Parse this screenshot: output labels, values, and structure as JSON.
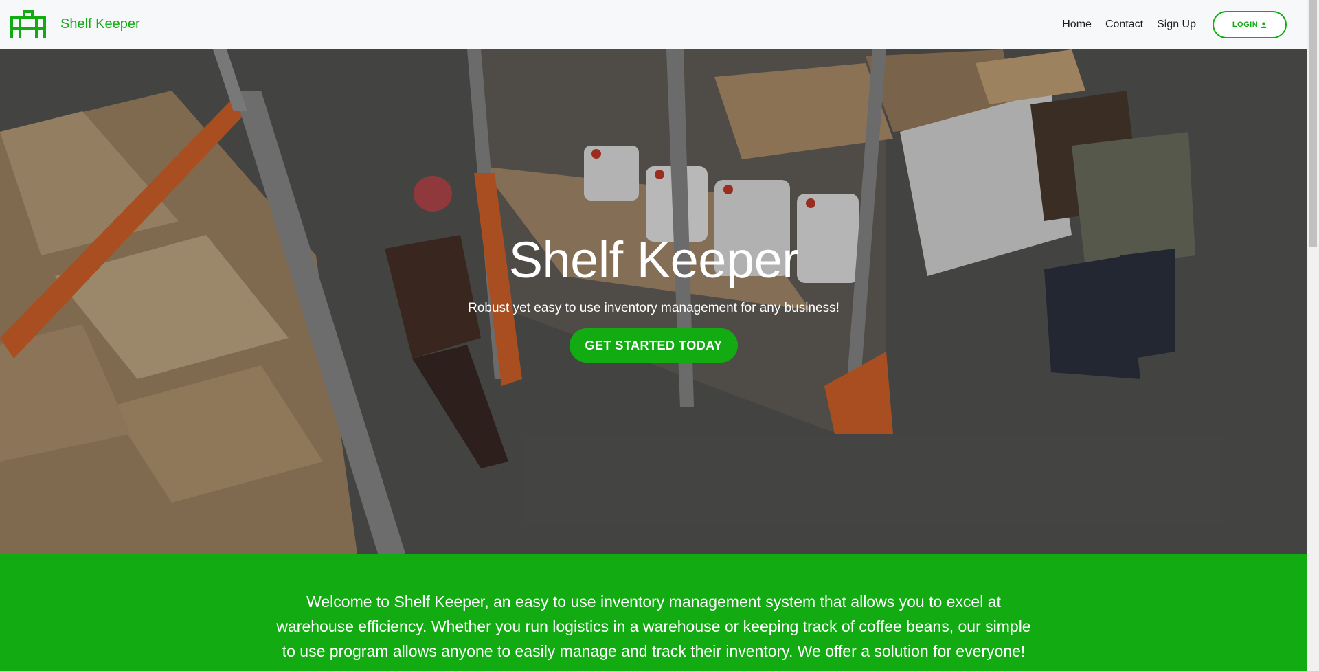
{
  "brand": {
    "name": "Shelf Keeper",
    "logo_icon": "shelf-logo-icon",
    "color": "#12ac12"
  },
  "nav": {
    "links": [
      "Home",
      "Contact",
      "Sign Up"
    ],
    "login_label": "LOGIN",
    "login_icon": "user-icon"
  },
  "hero": {
    "title": "Shelf Keeper",
    "subtitle": "Robust yet easy to use inventory management for any business!",
    "cta_label": "GET STARTED TODAY"
  },
  "welcome": {
    "text": "Welcome to Shelf Keeper, an easy to use inventory management system that allows you to excel at warehouse efficiency. Whether you run logistics in a warehouse or keeping track of coffee beans, our simple to use program allows anyone to easily manage and track their inventory. We offer a solution for everyone!"
  },
  "colors": {
    "accent": "#12ac12",
    "navbar_bg": "#f7f8fa",
    "text_dark": "#1d1d1d"
  }
}
